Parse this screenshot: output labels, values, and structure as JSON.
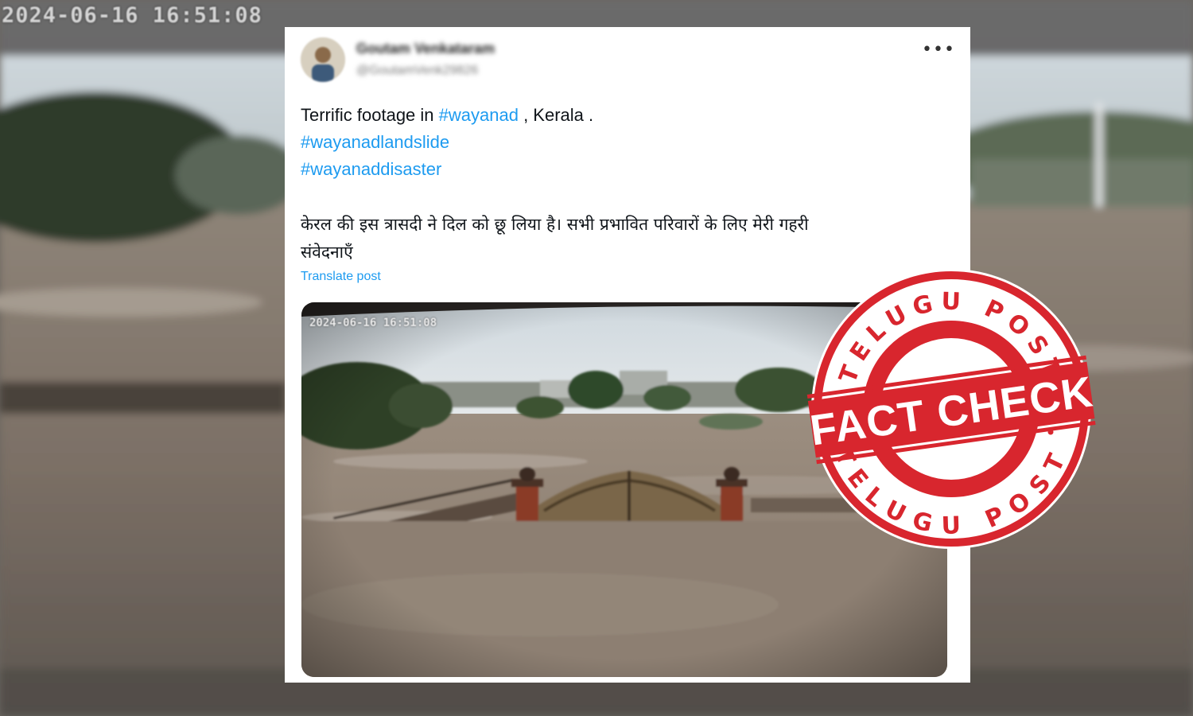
{
  "background": {
    "timestamp": "2024-06-16  16:51:08"
  },
  "tweet": {
    "author_name": "Goutam Venkataram",
    "author_handle": "@GoutamVenk29826",
    "more_icon": "more-horizontal-icon",
    "text_prefix": "Terrific footage in ",
    "hashtag_1": "#wayanad",
    "text_suffix": " , Kerala .",
    "hashtag_2": "#wayanadlandslide",
    "hashtag_3": "#wayanaddisaster",
    "hindi_line_1": "केरल की इस त्रासदी ने दिल को छू लिया है। सभी प्रभावित परिवारों के लिए मेरी गहरी",
    "hindi_line_2": "संवेदनाएँ",
    "translate_label": "Translate post",
    "video_timestamp": "2024-06-16  16:51:08"
  },
  "stamp": {
    "top_text": "TELUGU POST",
    "center_text": "FACT CHECK",
    "bottom_text": "TELUGU POST",
    "color": "#d8262e"
  },
  "colors": {
    "link": "#1d9bf0",
    "text": "#0f1419",
    "stamp_red": "#d8262e"
  }
}
